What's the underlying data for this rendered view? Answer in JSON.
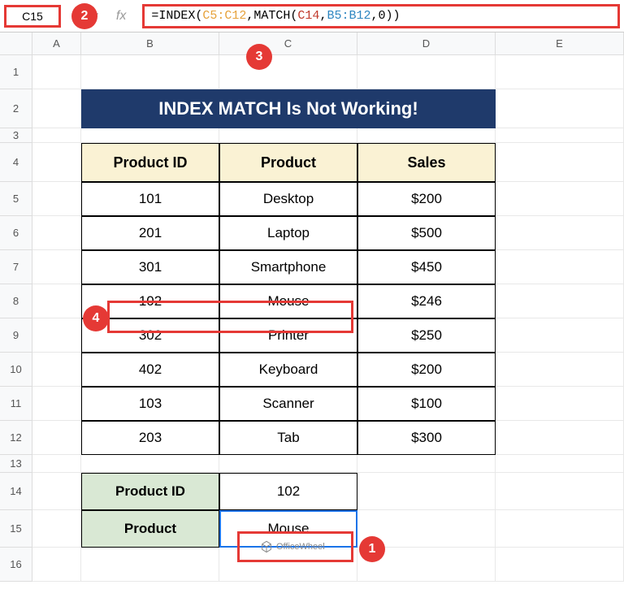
{
  "name_box": "C15",
  "formula": {
    "prefix": "=INDEX(",
    "range1": "C5:C12",
    "sep1": ",",
    "match_prefix": "MATCH(",
    "range2": "C14",
    "sep2": ",",
    "range3": "B5:B12",
    "sep3": ",",
    "zero": "0",
    "suffix": "))"
  },
  "fx_label": "fx",
  "columns": [
    "A",
    "B",
    "C",
    "D",
    "E"
  ],
  "rows": [
    "1",
    "2",
    "3",
    "4",
    "5",
    "6",
    "7",
    "8",
    "9",
    "10",
    "11",
    "12",
    "13",
    "14",
    "15",
    "16"
  ],
  "title": "INDEX MATCH Is Not Working!",
  "headers": {
    "b": "Product ID",
    "c": "Product",
    "d": "Sales"
  },
  "data_rows": [
    {
      "id": "101",
      "product": "Desktop",
      "sales": "$200"
    },
    {
      "id": "201",
      "product": "Laptop",
      "sales": "$500"
    },
    {
      "id": "301",
      "product": "Smartphone",
      "sales": "$450"
    },
    {
      "id": "102",
      "product": "Mouse",
      "sales": "$246"
    },
    {
      "id": "302",
      "product": "Printer",
      "sales": "$250"
    },
    {
      "id": "402",
      "product": "Keyboard",
      "sales": "$200"
    },
    {
      "id": "103",
      "product": "Scanner",
      "sales": "$100"
    },
    {
      "id": "203",
      "product": "Tab",
      "sales": "$300"
    }
  ],
  "lookup": {
    "label_id": "Product ID",
    "value_id": "102",
    "label_product": "Product",
    "value_product": "Mouse"
  },
  "callouts": {
    "c1": "1",
    "c2": "2",
    "c3": "3",
    "c4": "4"
  },
  "watermark": "OfficeWheel"
}
